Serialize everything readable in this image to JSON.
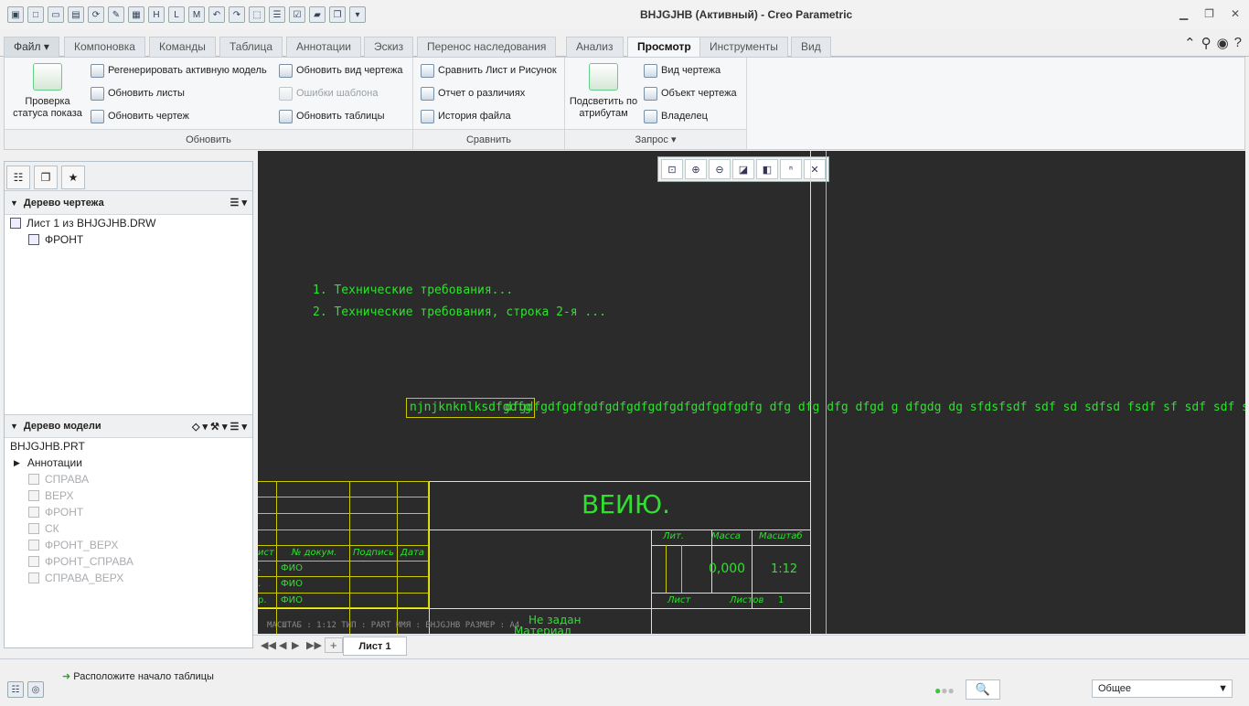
{
  "window": {
    "title": "BHJGJHB (Активный) - Creo Parametric"
  },
  "tabs": [
    "Файл",
    "Компоновка",
    "Команды",
    "Таблица",
    "Аннотации",
    "Эскиз",
    "Перенос наследования",
    "Анализ",
    "Просмотр",
    "Инструменты",
    "Вид"
  ],
  "active_tab": "Просмотр",
  "ribbon": {
    "check_status": "Проверка статуса показа",
    "update": {
      "regen": "Регенерировать активную модель",
      "sheets": "Обновить листы",
      "drawing": "Обновить чертеж",
      "view": "Обновить вид чертежа",
      "errors": "Ошибки шаблона",
      "tables": "Обновить таблицы",
      "label": "Обновить"
    },
    "compare": {
      "sheet_pic": "Сравнить Лист и Рисунок",
      "report": "Отчет о различиях",
      "history": "История файла",
      "label": "Сравнить"
    },
    "query": {
      "highlight": "Подсветить по атрибутам",
      "view": "Вид чертежа",
      "object": "Объект чертежа",
      "owner": "Владелец",
      "label": "Запрос"
    }
  },
  "drawing_tree": {
    "title": "Дерево чертежа",
    "items": [
      "Лист 1 из BHJGJHB.DRW",
      "ФРОНТ"
    ]
  },
  "model_tree": {
    "title": "Дерево модели",
    "root": "BHJGJHB.PRT",
    "annotations": "Аннотации",
    "items": [
      "СПРАВА",
      "ВЕРХ",
      "ФРОНТ",
      "СК",
      "ФРОНТ_ВЕРХ",
      "ФРОНТ_СПРАВА",
      "СПРАВА_ВЕРХ"
    ]
  },
  "drawing": {
    "note1": "1. Технические требования...",
    "note2": "2. Технические требования, строка 2-я ...",
    "line_boxed": "njnjknknlksdfgdfg",
    "line_rest": "dfgdfgdfgdfgdfgdfgdfgdfgdfgdfgdfgdfg dfg dfg dfg dfgd g dfgdg dg  sfdsfsdf sdf sd sdfsd fsdf sf sdf sdf sdf sdf sdfsdf sf",
    "title_name": "BEИЮ.",
    "lit": "Лит.",
    "mass": "Масса",
    "scale_h": "Масштаб",
    "mass_val": "0,000",
    "scale_val": "1:12",
    "sheet": "Лист",
    "sheets": "Листов",
    "sheets_val": "1",
    "col_list": "ист",
    "col_doc": "№ докум.",
    "col_sign": "Подпись",
    "col_date": "Дата",
    "fio": "ФИО",
    "r2": ".",
    "r3": "р.",
    "bottom_mono": "МАСШТАБ : 1:12    ТИП : PART   ИМЯ : BHJGJHB   РАЗМЕР : A4",
    "not_set": "Не задан",
    "material": "Материал"
  },
  "sheet_tab": "Лист 1",
  "status": {
    "message": "Расположите начало таблицы",
    "filter": "Общее"
  }
}
